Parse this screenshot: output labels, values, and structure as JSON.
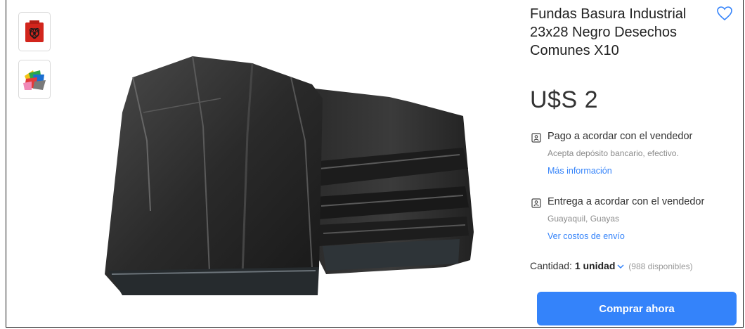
{
  "product": {
    "title": "Fundas Basura Industrial 23x28 Negro Desechos Comunes X10",
    "price": "U$S 2",
    "favorite_icon": "heart-outline-icon"
  },
  "thumbnails": [
    {
      "icon": "biohazard-bag-thumbnail"
    },
    {
      "icon": "colored-bags-thumbnail"
    }
  ],
  "payment": {
    "icon": "id-card-icon",
    "title": "Pago a acordar con el vendedor",
    "subtitle": "Acepta depósito bancario, efectivo.",
    "link": "Más información"
  },
  "delivery": {
    "icon": "id-card-icon",
    "title": "Entrega a acordar con el vendedor",
    "subtitle": "Guayaquil, Guayas",
    "link": "Ver costos de envío"
  },
  "quantity": {
    "label": "Cantidad:",
    "value": "1 unidad",
    "available": "(988 disponibles)"
  },
  "buy_button": {
    "label": "Comprar ahora"
  },
  "colors": {
    "accent": "#3483fa",
    "text": "#333333",
    "muted": "#8c8c8c"
  }
}
